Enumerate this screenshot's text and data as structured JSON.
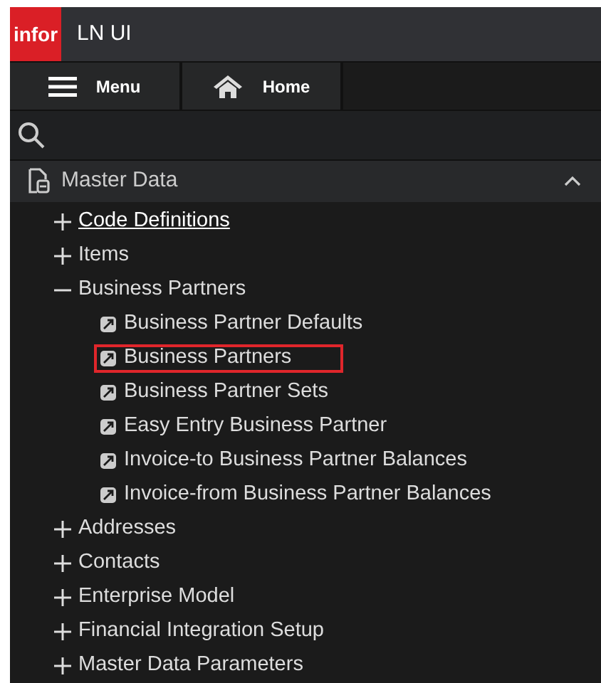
{
  "header": {
    "logo": "infor",
    "title": "LN UI"
  },
  "nav": [
    {
      "label": "Menu",
      "kind": "menu"
    },
    {
      "label": "Home",
      "kind": "home"
    }
  ],
  "section": {
    "title": "Master Data",
    "expanded": true
  },
  "tree": [
    {
      "label": "Code Definitions",
      "expanded": false,
      "hovered": true
    },
    {
      "label": "Items",
      "expanded": false,
      "hovered": false
    },
    {
      "label": "Business Partners",
      "expanded": true,
      "hovered": false,
      "children": [
        {
          "label": "Business Partner Defaults",
          "highlighted": false
        },
        {
          "label": "Business Partners",
          "highlighted": true
        },
        {
          "label": "Business Partner Sets",
          "highlighted": false
        },
        {
          "label": "Easy Entry Business Partner",
          "highlighted": false
        },
        {
          "label": "Invoice-to Business Partner Balances",
          "highlighted": false
        },
        {
          "label": "Invoice-from Business Partner Balances",
          "highlighted": false
        }
      ]
    },
    {
      "label": "Addresses",
      "expanded": false,
      "hovered": false
    },
    {
      "label": "Contacts",
      "expanded": false,
      "hovered": false
    },
    {
      "label": "Enterprise Model",
      "expanded": false,
      "hovered": false
    },
    {
      "label": "Financial Integration Setup",
      "expanded": false,
      "hovered": false
    },
    {
      "label": "Master Data Parameters",
      "expanded": false,
      "hovered": false
    }
  ]
}
